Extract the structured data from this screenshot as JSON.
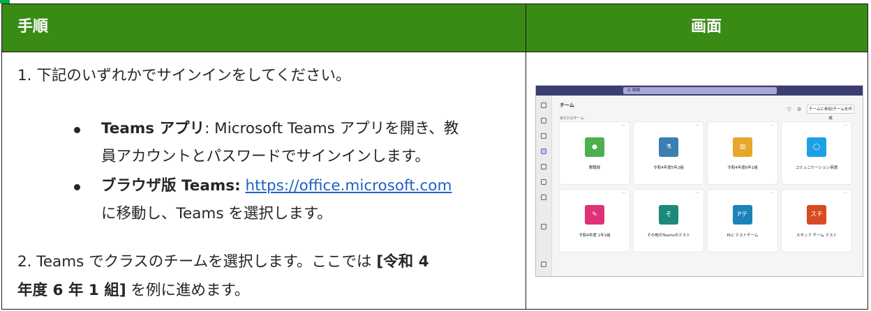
{
  "table": {
    "header_left": "手順",
    "header_right": "画面"
  },
  "step1": {
    "text": "1. 下記のいずれかでサインインをしてください。",
    "bullet1_bold": "Teams アプリ",
    "bullet1_line1": ": Microsoft Teams アプリを開き、教",
    "bullet1_line2": "員アカウントとパスワードでサインインします。",
    "bullet2_bold": "ブラウザ版 Teams:",
    "bullet2_link": "https://office.microsoft.com",
    "bullet2_line2": "に移動し、Teams を選択します。"
  },
  "step2": {
    "line1_pre": "2. Teams でクラスのチームを選択します。ここでは ",
    "line1_bold": "[令和 4",
    "line2_bold": "年度 6 年 1 組]",
    "line2_post": " を例に進めます。"
  },
  "screenshot": {
    "search_placeholder": "Q 検索",
    "title": "チーム",
    "subheading": "あなたのチーム",
    "join_button": "チームに参加/チームを作成",
    "more": "···",
    "teams": [
      {
        "name": "教職員",
        "icon": "speech-bubbles-icon",
        "color": "#4caf50"
      },
      {
        "name": "令和4年度5年2組",
        "icon": "microscope-icon",
        "color": "#3a7fb0"
      },
      {
        "name": "令和4年度6年1組",
        "icon": "books-icon",
        "color": "#e7a72b"
      },
      {
        "name": "コミュニケーション英語",
        "icon": "chat-icon",
        "color": "#1ea0e6"
      },
      {
        "name": "令和4年度 1年1組",
        "icon": "pencils-icon",
        "color": "#e0307a"
      },
      {
        "name": "その他のTeamsのテスト",
        "icon": "そ",
        "color": "#1c8a7a"
      },
      {
        "name": "PLC テストチーム",
        "icon": "Pテ",
        "color": "#1b83b8"
      },
      {
        "name": "スタッフ チーム テスト",
        "icon": "スチ",
        "color": "#d84a22"
      }
    ]
  }
}
